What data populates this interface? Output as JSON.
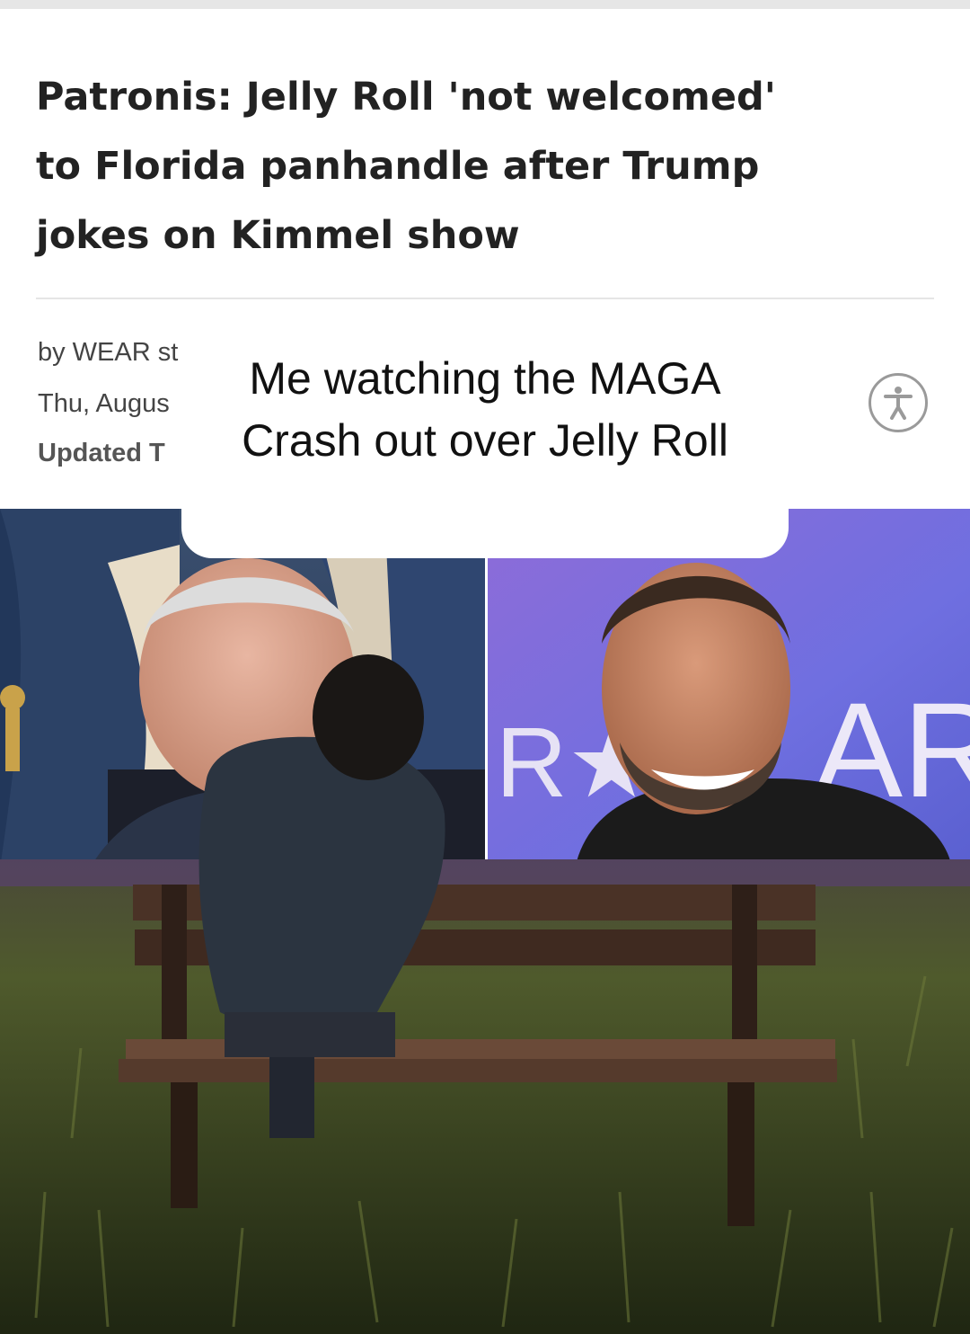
{
  "article": {
    "headline_lines": [
      "Patronis: Jelly Roll 'not welcomed'",
      "to Florida panhandle after Trump",
      "jokes on Kimmel show"
    ],
    "byline": "by WEAR st",
    "date": "Thu, Augus",
    "updated": "Updated T"
  },
  "accessibility": {
    "icon": "accessibility-icon"
  },
  "caption": {
    "line1": "Me watching the MAGA",
    "line2": "Crash out over Jelly Roll"
  },
  "photo": {
    "backdrop_text": "R★S",
    "backdrop_text_right": "ARC",
    "colors": {
      "grass": "#3d4a24",
      "sky_right": "#6f6fe0",
      "curtain": "#2f4468"
    }
  }
}
